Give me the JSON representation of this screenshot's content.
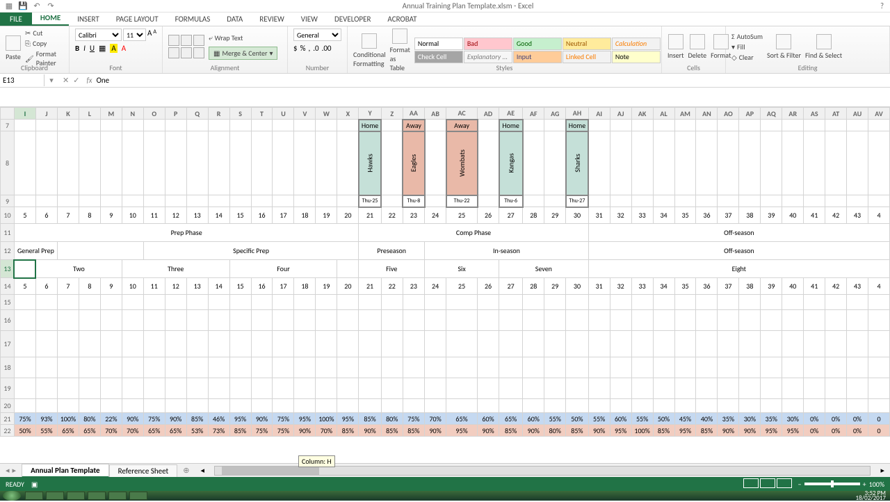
{
  "title": "Annual Training Plan Template.xlsm - Excel",
  "help_icon": "?",
  "tabs": [
    "FILE",
    "HOME",
    "INSERT",
    "PAGE LAYOUT",
    "FORMULAS",
    "DATA",
    "REVIEW",
    "VIEW",
    "DEVELOPER",
    "ACROBAT"
  ],
  "active_tab": "HOME",
  "clipboard": {
    "label": "Clipboard",
    "paste": "Paste",
    "cut": "Cut",
    "copy": "Copy",
    "painter": "Format Painter"
  },
  "font": {
    "label": "Font",
    "name": "Calibri",
    "size": "11"
  },
  "alignment": {
    "label": "Alignment",
    "wrap": "Wrap Text",
    "merge": "Merge & Center"
  },
  "number": {
    "label": "Number",
    "format": "General"
  },
  "styles": {
    "label": "Styles",
    "cond": "Conditional Formatting",
    "fmt": "Format as Table",
    "names": [
      "Normal",
      "Bad",
      "Good",
      "Neutral",
      "Calculation",
      "Check Cell",
      "Explanatory ...",
      "Input",
      "Linked Cell",
      "Note"
    ]
  },
  "cells": {
    "label": "Cells",
    "insert": "Insert",
    "delete": "Delete",
    "format": "Format"
  },
  "editing": {
    "label": "Editing",
    "sum": "AutoSum",
    "fill": "Fill",
    "clear": "Clear",
    "sort": "Sort & Filter",
    "find": "Find & Select"
  },
  "namebox": "E13",
  "formula": "One",
  "cols": [
    "I",
    "J",
    "K",
    "L",
    "M",
    "N",
    "O",
    "P",
    "Q",
    "R",
    "S",
    "T",
    "U",
    "V",
    "W",
    "X",
    "Y",
    "Z",
    "AA",
    "AB",
    "AC",
    "AD",
    "AE",
    "AF",
    "AG",
    "AH",
    "AI",
    "AJ",
    "AK",
    "AL",
    "AM",
    "AN",
    "AO",
    "AP",
    "AQ",
    "AR",
    "AS",
    "AT",
    "AU",
    "AV"
  ],
  "active_col": "I",
  "rows_header": [
    "7",
    "8",
    "9",
    "10",
    "11",
    "12",
    "13",
    "14",
    "15",
    "16",
    "17",
    "18",
    "19",
    "20",
    "21",
    "22"
  ],
  "games": [
    {
      "col": 16,
      "type": "Home",
      "team": "Hawks",
      "date": "Thu-25"
    },
    {
      "col": 18,
      "type": "Away",
      "team": "Eagles",
      "date": "Thu-8"
    },
    {
      "col": 20,
      "type": "Away",
      "team": "Wombats",
      "date": "Thu-22"
    },
    {
      "col": 22,
      "type": "Home",
      "team": "Kangas",
      "date": "Thu-6"
    },
    {
      "col": 25,
      "type": "Home",
      "team": "Sharks",
      "date": "Thu-27"
    }
  ],
  "row10": [
    "5",
    "6",
    "7",
    "8",
    "9",
    "10",
    "11",
    "12",
    "13",
    "14",
    "15",
    "16",
    "17",
    "18",
    "19",
    "20",
    "21",
    "22",
    "23",
    "24",
    "25",
    "26",
    "27",
    "28",
    "29",
    "30",
    "31",
    "32",
    "33",
    "34",
    "35",
    "36",
    "37",
    "38",
    "39",
    "40",
    "41",
    "42",
    "43",
    "4"
  ],
  "row11": {
    "prep": "Prep Phase",
    "comp": "Comp Phase",
    "off": "Off-season"
  },
  "row12": {
    "gen": "General Prep",
    "spec": "Specific Prep",
    "pre": "Preseason",
    "in": "In-season",
    "off": "Off-season"
  },
  "row13": {
    "two": "Two",
    "three": "Three",
    "four": "Four",
    "five": "Five",
    "six": "Six",
    "seven": "Seven",
    "eight": "Eight"
  },
  "row14": [
    "5",
    "6",
    "7",
    "8",
    "9",
    "10",
    "11",
    "12",
    "13",
    "14",
    "15",
    "16",
    "17",
    "18",
    "19",
    "20",
    "21",
    "22",
    "23",
    "24",
    "25",
    "26",
    "27",
    "28",
    "29",
    "30",
    "31",
    "32",
    "33",
    "34",
    "35",
    "36",
    "37",
    "38",
    "39",
    "40",
    "41",
    "42",
    "43",
    "4"
  ],
  "row21": [
    "75%",
    "93%",
    "100%",
    "80%",
    "22%",
    "90%",
    "75%",
    "90%",
    "85%",
    "46%",
    "95%",
    "90%",
    "75%",
    "95%",
    "100%",
    "95%",
    "85%",
    "80%",
    "75%",
    "70%",
    "65%",
    "60%",
    "65%",
    "60%",
    "55%",
    "50%",
    "55%",
    "60%",
    "55%",
    "50%",
    "45%",
    "40%",
    "35%",
    "30%",
    "35%",
    "30%",
    "0%",
    "0%",
    "0%",
    "0"
  ],
  "row22": [
    "50%",
    "55%",
    "65%",
    "65%",
    "70%",
    "70%",
    "65%",
    "65%",
    "53%",
    "73%",
    "85%",
    "75%",
    "75%",
    "90%",
    "70%",
    "85%",
    "90%",
    "85%",
    "85%",
    "90%",
    "95%",
    "90%",
    "85%",
    "90%",
    "80%",
    "85%",
    "90%",
    "95%",
    "100%",
    "85%",
    "95%",
    "85%",
    "90%",
    "90%",
    "95%",
    "95%",
    "0%",
    "0%",
    "0%",
    "0"
  ],
  "sheets": {
    "active": "Annual Plan Template",
    "other": "Reference Sheet"
  },
  "tooltip": "Column: H",
  "status": "READY",
  "zoom": "100%",
  "clock": {
    "time": "3:52 PM",
    "date": "18/02/2017"
  }
}
